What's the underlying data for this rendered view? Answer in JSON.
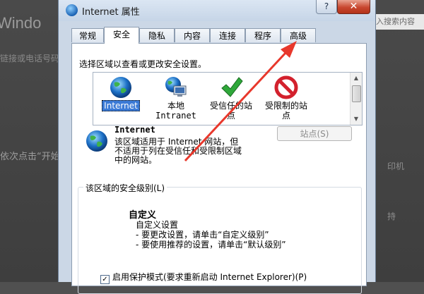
{
  "background": {
    "left_title": "Windo",
    "left_sub": "链接或电话号码",
    "left_step": "依次点击“开始",
    "search_text": "入搜索内容",
    "right_1": "印机",
    "right_2": "持"
  },
  "dialog": {
    "title": "Internet 属性",
    "help_label": "?",
    "close_label": "✕",
    "tabs": [
      "常规",
      "安全",
      "隐私",
      "内容",
      "连接",
      "程序",
      "高级"
    ],
    "active_tab": "安全",
    "zone_prompt": "选择区域以查看或更改安全设置。",
    "zones": [
      {
        "label": "Internet",
        "icon": "globe-icon"
      },
      {
        "label": "本地\nIntranet",
        "icon": "local-intranet-icon"
      },
      {
        "label": "受信任的站\n点",
        "icon": "trusted-checkmark-icon"
      },
      {
        "label": "受限制的站\n点",
        "icon": "restricted-icon"
      }
    ],
    "selected_zone": "Internet",
    "sites_button": "站点(S)",
    "zone_desc_title": "Internet",
    "zone_desc_lines": [
      "该区域适用于 Internet 网站，但",
      "不适用于列在受信任和受限制区域",
      "中的网站。"
    ],
    "security_level_legend": "该区域的安全级别(L)",
    "custom_title": "自定义",
    "custom_lines": [
      "自定义设置",
      "- 要更改设置，请单击“自定义级别”",
      "- 要使用推荐的设置，请单击“默认级别”"
    ],
    "protected_mode_label": "启用保护模式(要求重新启动 Internet Explorer)(P)",
    "protected_mode_checked": true
  },
  "colors": {
    "annotation_arrow": "#e8382c",
    "selection": "#3b7ad6"
  }
}
